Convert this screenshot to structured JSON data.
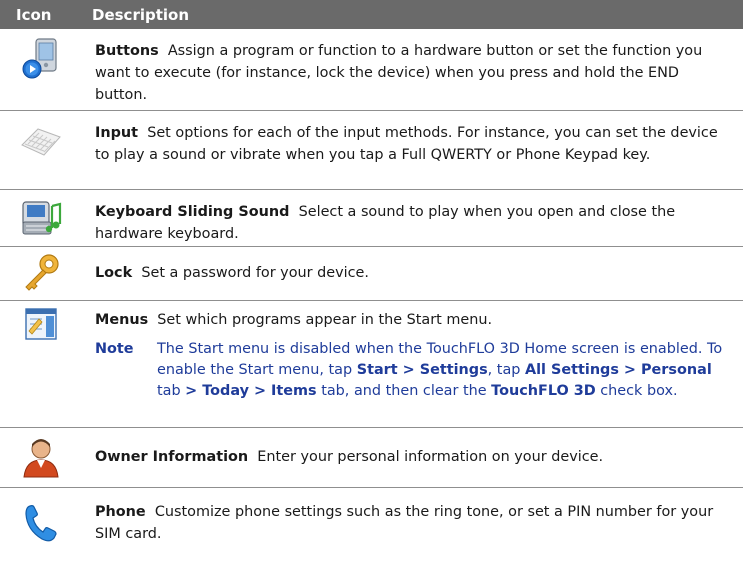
{
  "header": {
    "icon_col": "Icon",
    "desc_col": "Description"
  },
  "rows": [
    {
      "icon": "buttons-icon",
      "title": "Buttons",
      "desc": "Assign a program or function to a hardware button or set the function you want to execute (for instance, lock the device) when you press and hold the END button."
    },
    {
      "icon": "keyboard-icon",
      "title": "Input",
      "desc": "Set options for each of the input methods. For instance, you can set the device to play a sound or vibrate when you tap a Full QWERTY or Phone Keypad key."
    },
    {
      "icon": "keyboard-sound-icon",
      "title": "Keyboard Sliding Sound",
      "desc": "Select a sound to play when you open and close the hardware keyboard."
    },
    {
      "icon": "lock-key-icon",
      "title": "Lock",
      "desc": "Set a password for your device."
    },
    {
      "icon": "menus-icon",
      "title": "Menus",
      "desc": "Set which programs appear in the Start menu.",
      "note": {
        "label": "Note",
        "t1": "The Start menu is disabled when the TouchFLO 3D Home screen is enabled. To enable the Start menu, tap ",
        "b1": "Start > Settings",
        "t2": ", tap ",
        "b2": "All Settings > Personal",
        "t3": " tab ",
        "b3": "> Today > Items",
        "t4": " tab, and then clear the ",
        "b4": "TouchFLO 3D",
        "t5": " check box."
      }
    },
    {
      "icon": "owner-icon",
      "title": "Owner Information",
      "desc": "Enter your personal information on your device."
    },
    {
      "icon": "phone-icon",
      "title": "Phone",
      "desc": "Customize phone settings such as the ring tone, or set a PIN number for your SIM card."
    }
  ]
}
